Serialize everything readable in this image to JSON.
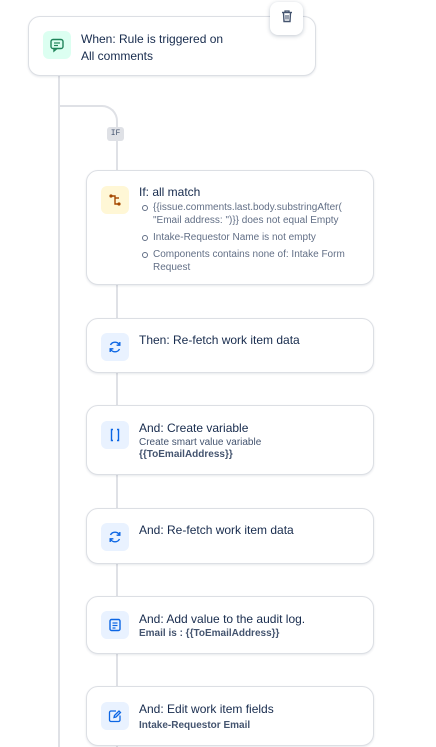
{
  "trigger": {
    "title": "When: Rule is triggered on",
    "subtitle": "All comments",
    "icon": "comment-icon",
    "color": "#dcfff1"
  },
  "delete_icon": "trash-icon",
  "branch": {
    "badge": "IF"
  },
  "condition": {
    "title": "If: all match",
    "icon": "branch-icon",
    "color": "#fff7d6",
    "items": [
      "{{issue.comments.last.body.substringAfter( \"Email address: \")}} does not equal Empty",
      "Intake-Requestor Name is not empty",
      "Components contains none of: Intake Form Request"
    ]
  },
  "actions": [
    {
      "title": "Then: Re-fetch work item data",
      "icon": "refresh-icon"
    },
    {
      "title": "And: Create variable",
      "subtitle": "Create smart value variable",
      "detail": "{{ToEmailAddress}}",
      "icon": "braces-icon"
    },
    {
      "title": "And: Re-fetch work item data",
      "icon": "refresh-icon"
    },
    {
      "title": "And: Add value to the audit log.",
      "detail": "Email is : {{ToEmailAddress}}",
      "icon": "log-icon"
    },
    {
      "title": "And: Edit work item fields",
      "detail": "Intake-Requestor Email",
      "icon": "edit-icon"
    }
  ],
  "colors": {
    "action_icon_bg": "#e9f2ff",
    "action_icon": "#0c66e4",
    "connector": "#dfe1e6"
  }
}
